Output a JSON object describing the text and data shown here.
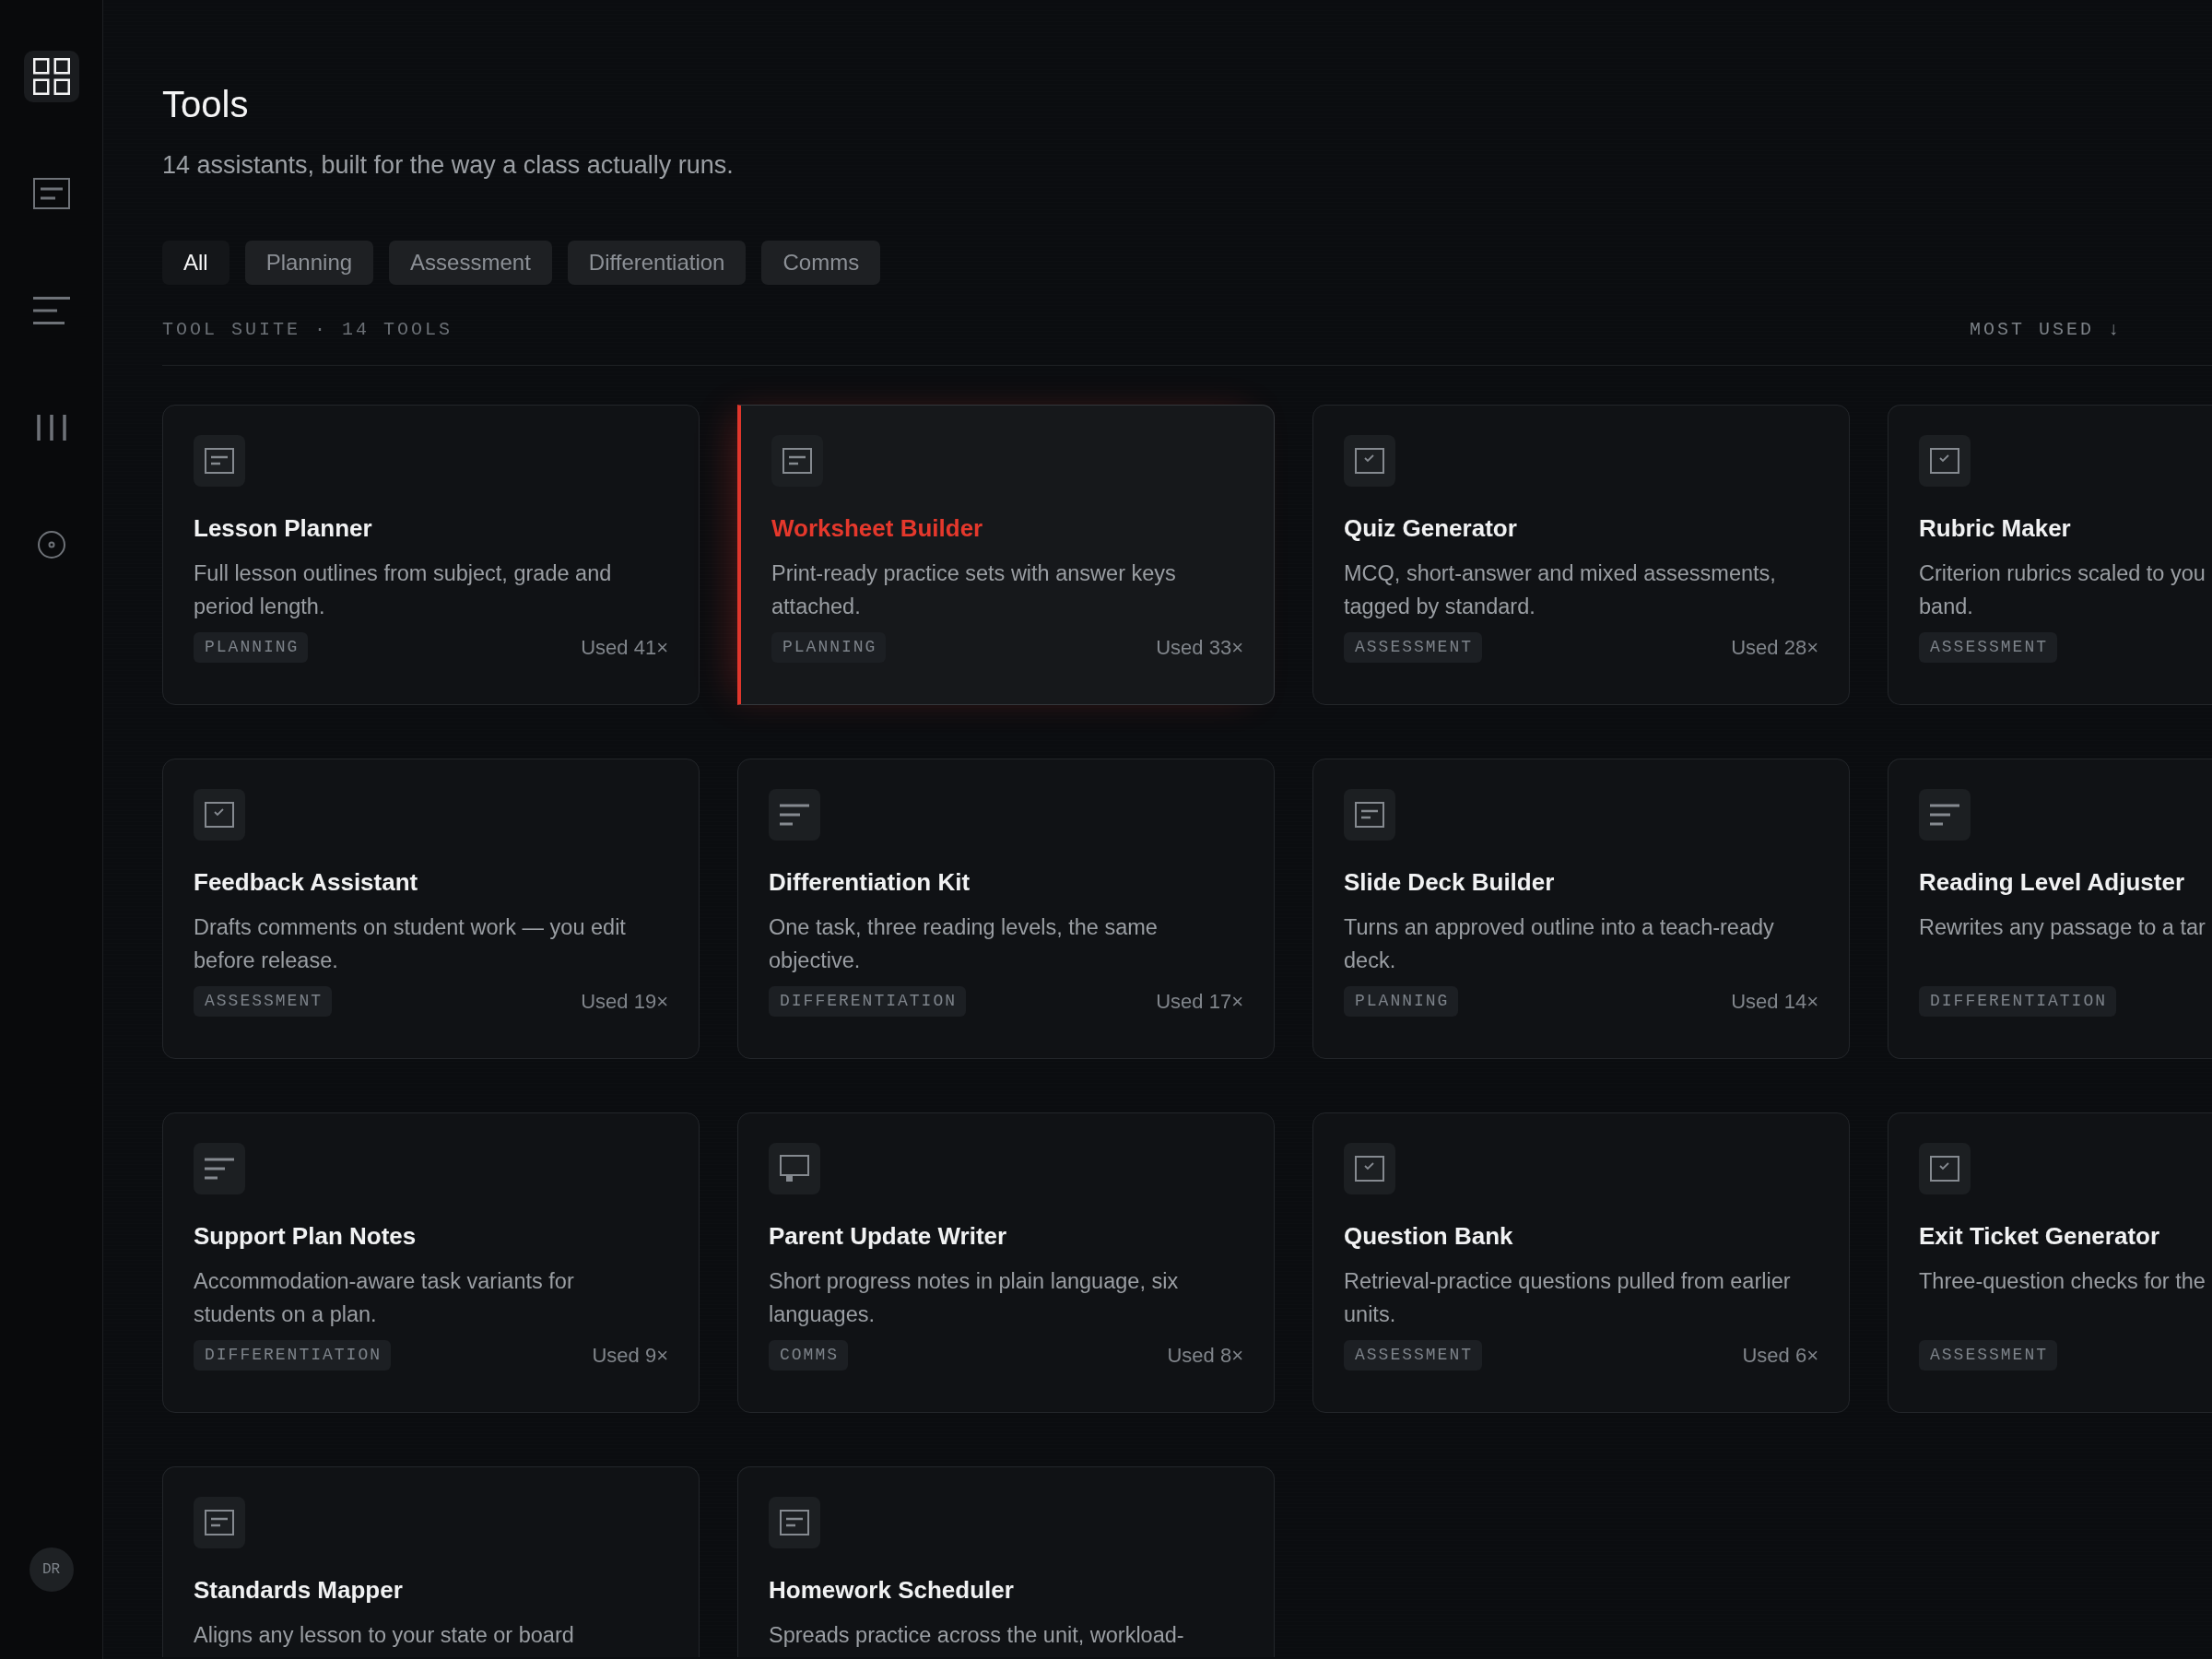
{
  "sidebar": {
    "items": [
      {
        "kind": "grid",
        "selected": true
      },
      {
        "kind": "document",
        "selected": false
      },
      {
        "kind": "lines",
        "selected": false
      },
      {
        "kind": "bars",
        "selected": false
      },
      {
        "kind": "target",
        "selected": false
      }
    ],
    "avatar": {
      "initials": "DR"
    }
  },
  "header": {
    "title": "Tools",
    "subtitle": "14 assistants, built for the way a class actually runs."
  },
  "filters": [
    {
      "label": "All",
      "selected": true
    },
    {
      "label": "Planning",
      "selected": false
    },
    {
      "label": "Assessment",
      "selected": false
    },
    {
      "label": "Differentiation",
      "selected": false
    },
    {
      "label": "Comms",
      "selected": false
    }
  ],
  "section": {
    "label": "TOOL SUITE · 14 TOOLS",
    "sort": "MOST USED ↓"
  },
  "tools": [
    {
      "kind": "document",
      "name": "Lesson Planner",
      "description": "Full lesson outlines from subject, grade and\nperiod length.",
      "tag": "PLANNING",
      "usage": "Used 41×",
      "selected": false
    },
    {
      "kind": "document",
      "name": "Worksheet Builder",
      "description": "Print-ready practice sets with answer keys\nattached.",
      "tag": "PLANNING",
      "usage": "Used 33×",
      "selected": true
    },
    {
      "kind": "checklist",
      "name": "Quiz Generator",
      "description": "MCQ, short-answer and mixed assessments,\ntagged by standard.",
      "tag": "ASSESSMENT",
      "usage": "Used 28×",
      "selected": false
    },
    {
      "kind": "checklist",
      "name": "Rubric Maker",
      "description": "Criterion rubrics scaled to you\nband.",
      "tag": "ASSESSMENT",
      "selected": false
    },
    {
      "kind": "checklist",
      "name": "Feedback Assistant",
      "description": "Drafts comments on student work — you edit\nbefore release.",
      "tag": "ASSESSMENT",
      "usage": "Used 19×",
      "selected": false
    },
    {
      "kind": "lines",
      "name": "Differentiation Kit",
      "description": "One task, three reading levels, the same\nobjective.",
      "tag": "DIFFERENTIATION",
      "usage": "Used 17×",
      "selected": false
    },
    {
      "kind": "document",
      "name": "Slide Deck Builder",
      "description": "Turns an approved outline into a teach-ready\ndeck.",
      "tag": "PLANNING",
      "usage": "Used 14×",
      "selected": false
    },
    {
      "kind": "lines",
      "name": "Reading Level Adjuster",
      "description": "Rewrites any passage to a tar",
      "tag": "DIFFERENTIATION",
      "selected": false
    },
    {
      "kind": "lines",
      "name": "Support Plan Notes",
      "description": "Accommodation-aware task variants for\nstudents on a plan.",
      "tag": "DIFFERENTIATION",
      "usage": "Used 9×",
      "selected": false
    },
    {
      "kind": "monitor",
      "name": "Parent Update Writer",
      "description": "Short progress notes in plain language, six\nlanguages.",
      "tag": "COMMS",
      "usage": "Used 8×",
      "selected": false
    },
    {
      "kind": "checklist",
      "name": "Question Bank",
      "description": "Retrieval-practice questions pulled from earlier\nunits.",
      "tag": "ASSESSMENT",
      "usage": "Used 6×",
      "selected": false
    },
    {
      "kind": "checklist",
      "name": "Exit Ticket Generator",
      "description": "Three-question checks for the",
      "tag": "ASSESSMENT",
      "selected": false
    },
    {
      "kind": "document",
      "name": "Standards Mapper",
      "description": "Aligns any lesson to your state or board",
      "selected": false
    },
    {
      "kind": "document",
      "name": "Homework Scheduler",
      "description": "Spreads practice across the unit, workload-",
      "selected": false
    }
  ]
}
